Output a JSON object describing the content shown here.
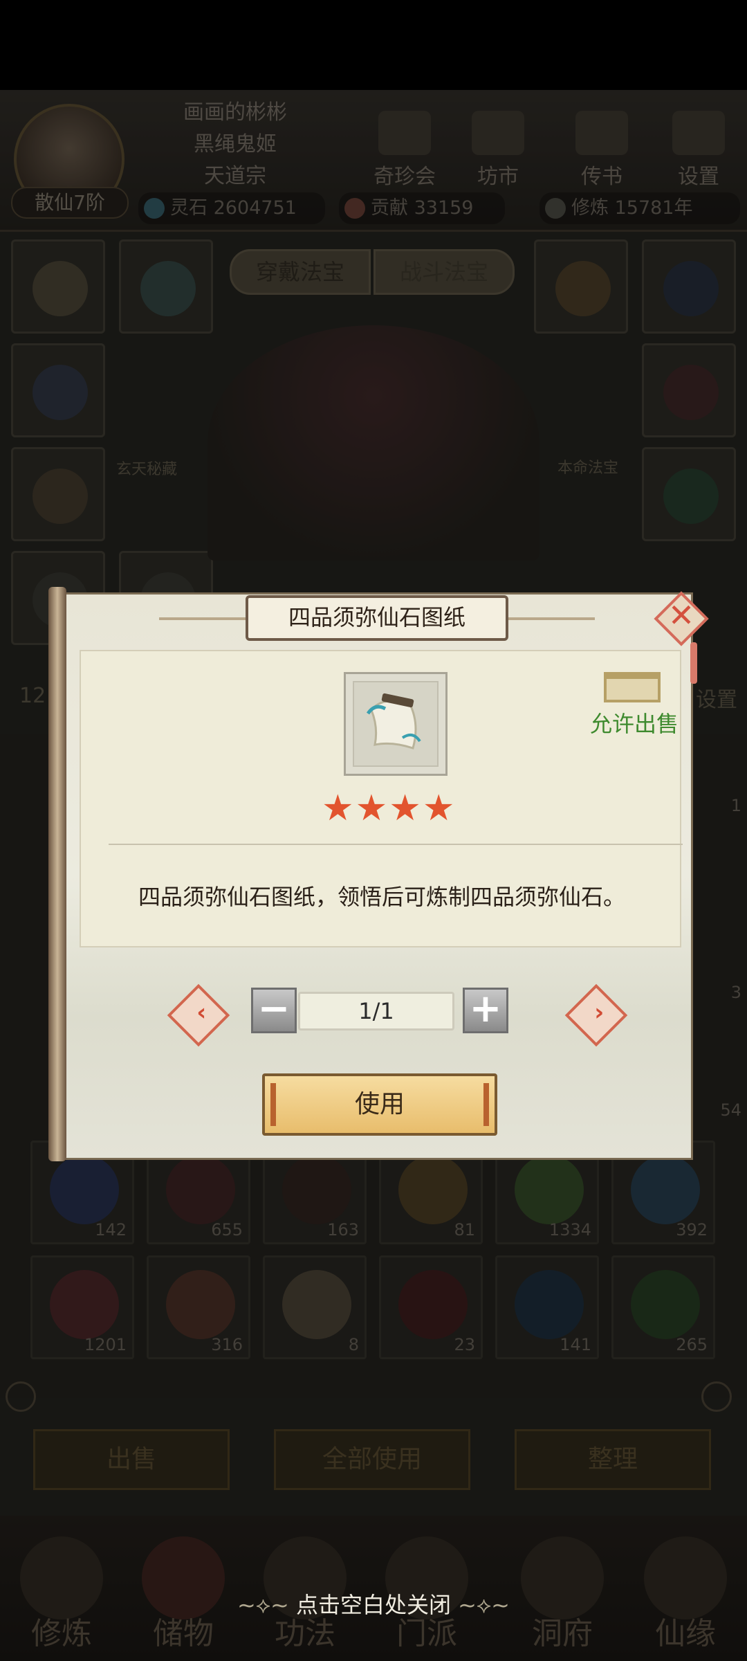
{
  "profile": {
    "names": [
      "画画的彬彬",
      "黑绳鬼姬",
      "天道宗"
    ],
    "realm": "散仙7阶"
  },
  "top_nav": [
    {
      "label": "奇珍会",
      "icon": "treasure-chest-icon"
    },
    {
      "label": "坊市",
      "icon": "market-icon"
    },
    {
      "label": "传书",
      "icon": "letter-icon"
    },
    {
      "label": "设置",
      "icon": "gear-icon"
    }
  ],
  "resources": {
    "spirit_stone": "灵石 2604751",
    "contribution": "贡献 33159",
    "cultivation": "修炼 15781年"
  },
  "equip_tabs": {
    "wear": "穿戴法宝",
    "battle": "战斗法宝"
  },
  "side_labels": {
    "left": "玄天秘藏",
    "right": "本命法宝"
  },
  "partial_labels": {
    "left_num": "12",
    "right_setting": "设置"
  },
  "bag_counts": {
    "row1": [
      "142",
      "655",
      "163",
      "81",
      "1334",
      "392"
    ],
    "row2": [
      "1201",
      "316",
      "8",
      "23",
      "141",
      "265"
    ],
    "side_right": [
      "1",
      "3",
      "54"
    ]
  },
  "bag_buttons": {
    "sell": "出售",
    "use_all": "全部使用",
    "sort": "整理"
  },
  "bottom_nav": [
    "修炼",
    "储物",
    "功法",
    "门派",
    "洞府",
    "仙缘"
  ],
  "dialog": {
    "title": "四品须弥仙石图纸",
    "sell_status": "允许出售",
    "stars": "★★★★",
    "star_count": 4,
    "description": "四品须弥仙石图纸，领悟后可炼制四品须弥仙石。",
    "quantity": "1/1",
    "minus": "−",
    "plus": "+",
    "use_button": "使用",
    "close": "✕"
  },
  "hint": "点击空白处关闭",
  "colors": {
    "sell_green": "#3e8a2e",
    "star_red": "#e2542e",
    "use_gold": "#e8bd6c"
  }
}
